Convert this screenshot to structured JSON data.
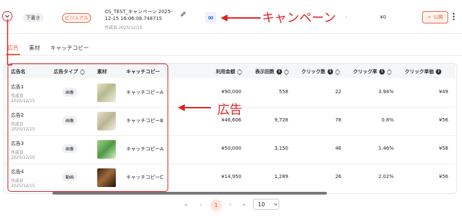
{
  "campaign": {
    "status": "下書き",
    "type": "ビジュアル",
    "name_line1": "CS_TEST_キャンペーン 2025-",
    "name_line2": "12-15 16:06:08.748715",
    "created": "作成日 2025/12/15",
    "dash": "-",
    "spend": "¥0",
    "publish_label": "公開",
    "publish_plus": "+",
    "annotation": "キャンペーン",
    "platform_glyph": "∞"
  },
  "tabs": [
    "広告",
    "素材",
    "キャッチコピー"
  ],
  "columns": {
    "name": "広告名",
    "type": "広告タイプ",
    "material": "素材",
    "copy": "キャッチコピー",
    "spend": "利用金額",
    "impressions": "表示回数",
    "clicks": "クリック数",
    "ctr": "クリック率",
    "cpc": "クリック単価"
  },
  "info_glyph": "i",
  "ads": [
    {
      "name": "広告1",
      "created": "作成日",
      "date": "2025/12/15",
      "type": "画像",
      "copy": "キャッチコピーA",
      "spend": "¥90,000",
      "impressions": "558",
      "clicks": "22",
      "ctr": "3.94%",
      "cpc": "¥49"
    },
    {
      "name": "広告2",
      "created": "作成日",
      "date": "2025/12/15",
      "type": "画像",
      "copy": "キャッチコピーB",
      "spend": "¥46,606",
      "impressions": "9,728",
      "clicks": "78",
      "ctr": "0.8%",
      "cpc": "¥56"
    },
    {
      "name": "広告3",
      "created": "作成日",
      "date": "2025/12/15",
      "type": "画像",
      "copy": "キャッチコピーA",
      "spend": "¥50,000",
      "impressions": "3,150",
      "clicks": "46",
      "ctr": "1.46%",
      "cpc": "¥58"
    },
    {
      "name": "広告4",
      "created": "作成日",
      "date": "2025/12/15",
      "type": "動画",
      "copy": "キャッチコピーC",
      "spend": "¥14,950",
      "impressions": "1,289",
      "clicks": "26",
      "ctr": "2.02%",
      "cpc": "¥56"
    }
  ],
  "annotation_ads": "広告",
  "pagination": {
    "first": "«",
    "prev": "‹",
    "current": "1",
    "next": "›",
    "last": "»",
    "page_size": "10"
  },
  "colors": {
    "accent": "#e8643c",
    "annotation": "#e02020",
    "tab_active": "#e8643c"
  },
  "icons": {
    "expand": "chevron-down-icon",
    "edit": "pencil-icon",
    "meta": "meta-logo-icon",
    "more": "more-vertical-icon"
  }
}
